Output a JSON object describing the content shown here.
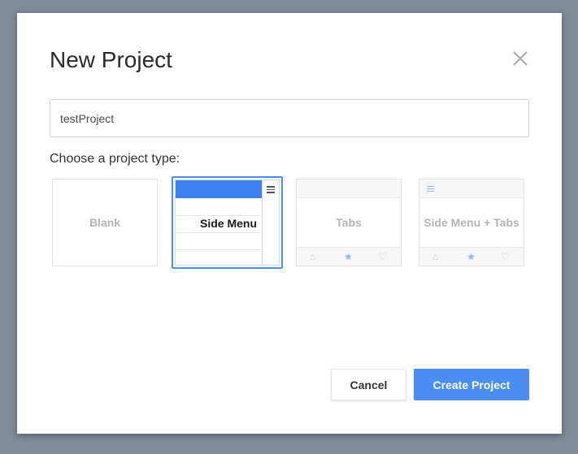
{
  "dialog": {
    "title": "New Project",
    "close_icon": "close-icon"
  },
  "project_name": {
    "value": "testProject"
  },
  "project_type": {
    "label": "Choose a project type:",
    "options": [
      {
        "label": "Blank",
        "selected": false
      },
      {
        "label": "Side Menu",
        "selected": true
      },
      {
        "label": "Tabs",
        "selected": false
      },
      {
        "label": "Side Menu + Tabs",
        "selected": false
      }
    ]
  },
  "buttons": {
    "cancel": "Cancel",
    "create": "Create Project"
  },
  "colors": {
    "accent": "#4a8ef2",
    "backdrop": "#818c98"
  }
}
